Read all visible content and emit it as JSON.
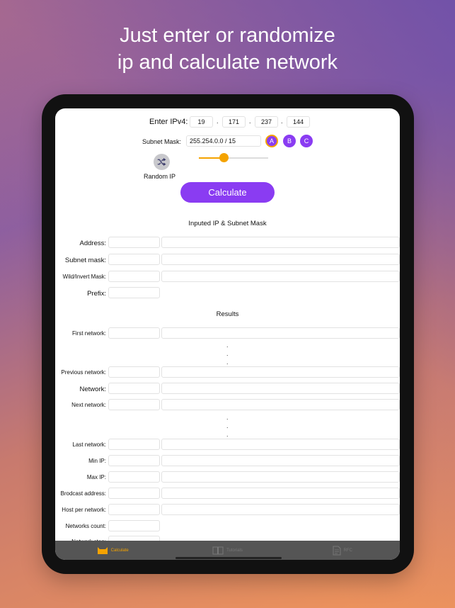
{
  "headline": {
    "line1": "Just enter or randomize",
    "line2": "ip and calculate network"
  },
  "ip_input": {
    "label": "Enter IPv4:",
    "octets": [
      "19",
      "171",
      "237",
      "144"
    ],
    "separator": "."
  },
  "subnet": {
    "label": "Subnet Mask:",
    "value": "255.254.0.0 / 15",
    "classes": [
      "A",
      "B",
      "C"
    ],
    "selected_class": "A",
    "slider_fraction": 0.36
  },
  "random": {
    "label": "Random IP"
  },
  "calculate": {
    "label": "Calculate"
  },
  "inputed_section": {
    "title": "Inputed IP & Subnet Mask",
    "rows": [
      {
        "label": "Address:"
      },
      {
        "label": "Subnet mask:"
      },
      {
        "label": "Wild/Invert Mask:"
      },
      {
        "label": "Prefix:"
      }
    ]
  },
  "results_section": {
    "title": "Results",
    "rows": [
      {
        "label": "First network:"
      },
      {
        "label": "Previous network:"
      },
      {
        "label": "Network:"
      },
      {
        "label": "Next network:"
      },
      {
        "label": "Last network:"
      },
      {
        "label": "Min IP:"
      },
      {
        "label": "Max IP:"
      },
      {
        "label": "Brodcast address:"
      },
      {
        "label": "Host per network:"
      },
      {
        "label": "Networks count:"
      },
      {
        "label": "Network step:"
      }
    ],
    "ellipsis": "."
  },
  "tabs": [
    {
      "label": "Calculate",
      "icon": "cat-icon"
    },
    {
      "label": "Tutorials",
      "icon": "book-icon"
    },
    {
      "label": "RFC",
      "icon": "document-icon"
    }
  ],
  "colors": {
    "accent": "#8a3cf2",
    "highlight": "#f4a300",
    "tabbar": "#555555"
  }
}
